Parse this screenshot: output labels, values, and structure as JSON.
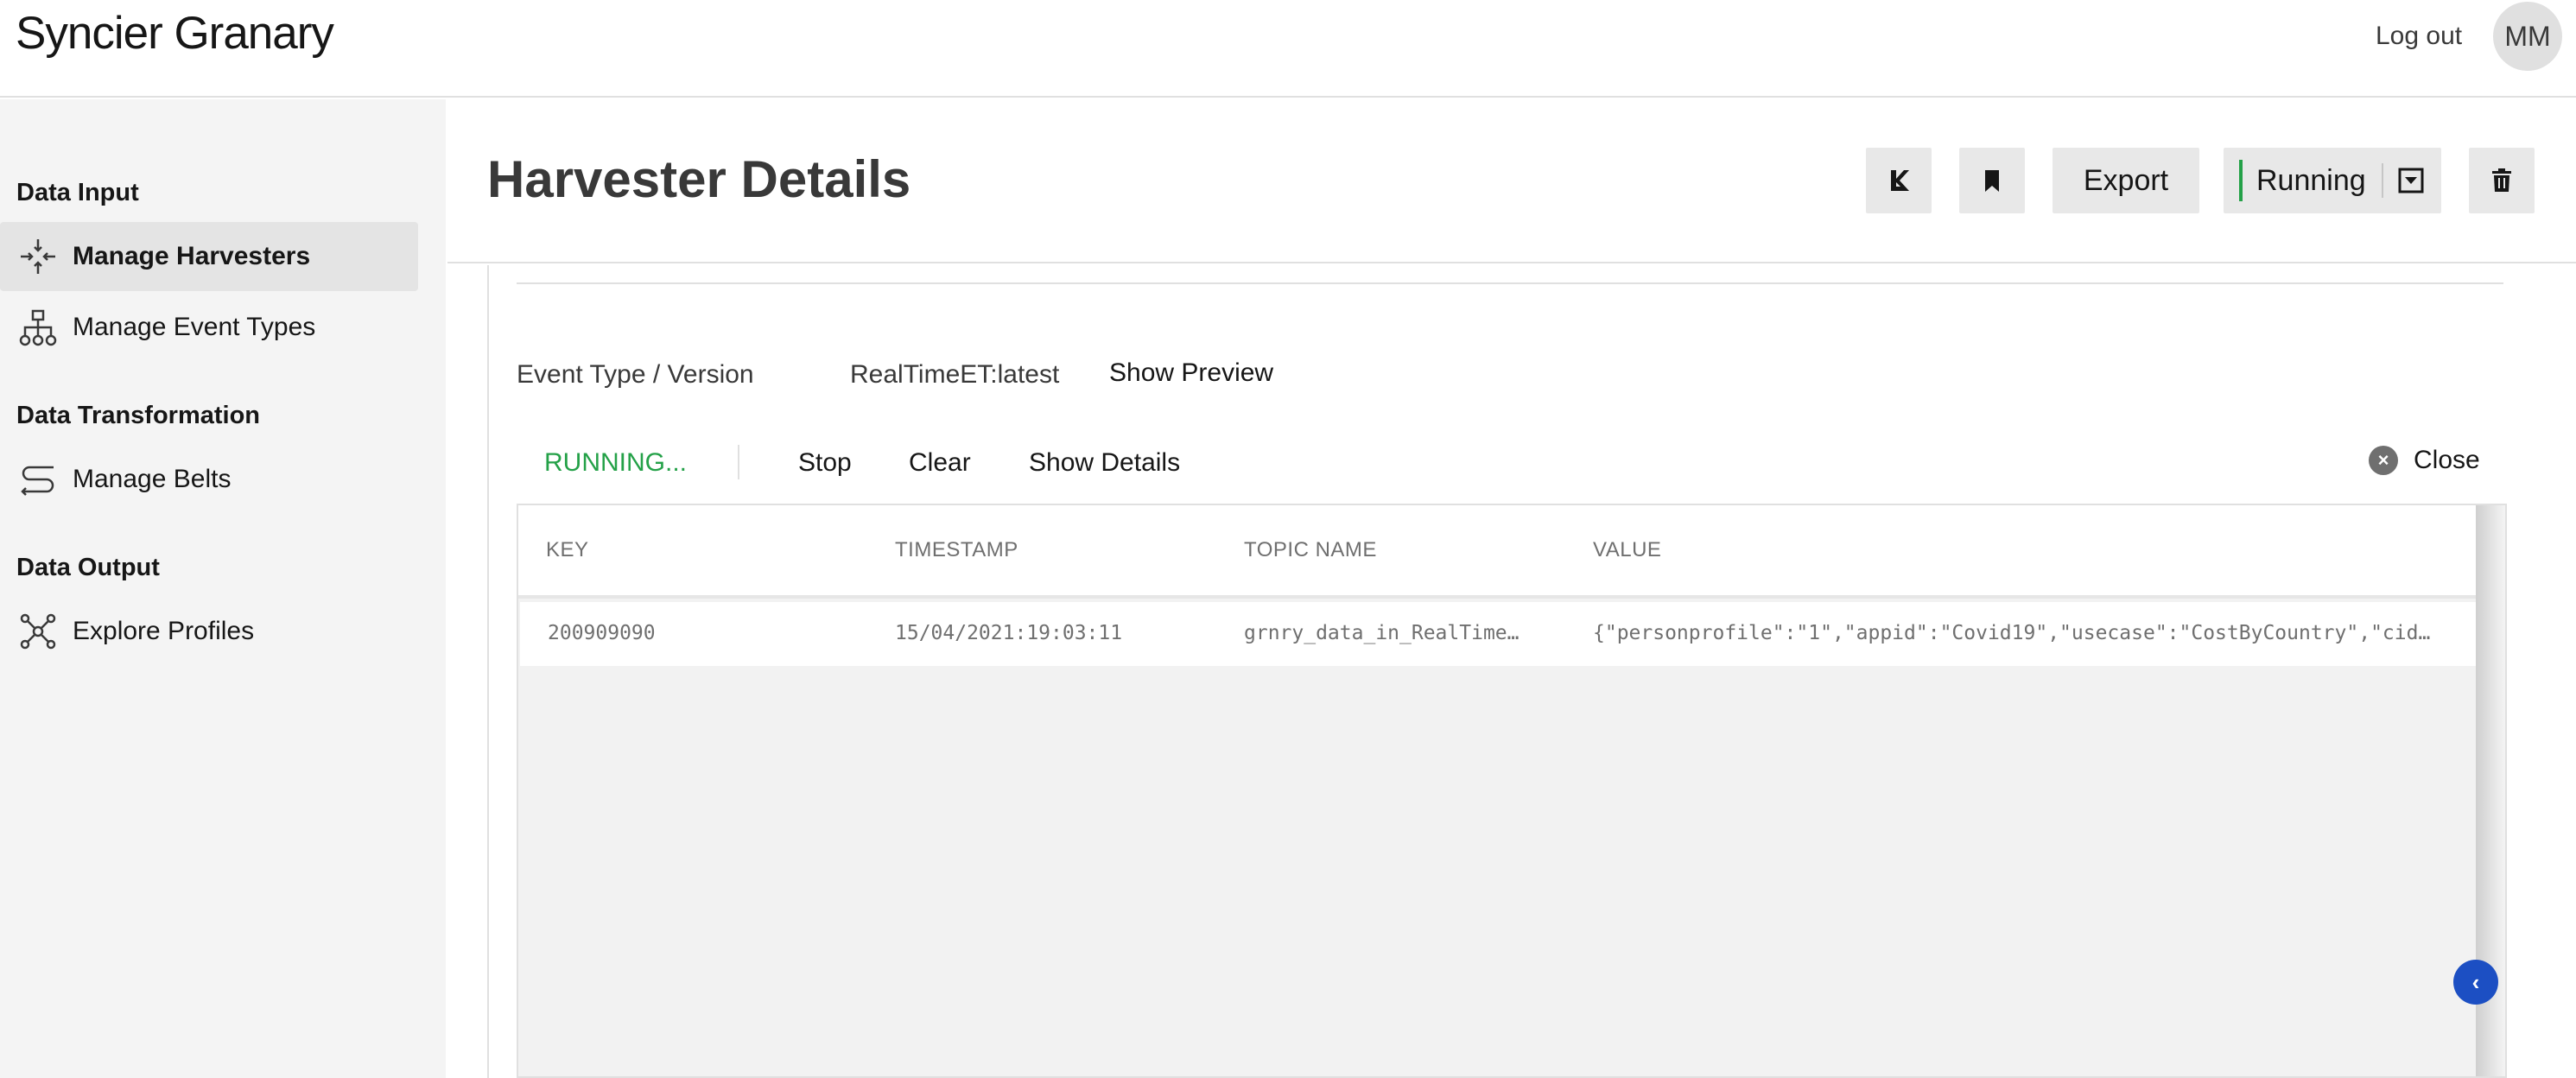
{
  "app": {
    "title": "Syncier Granary",
    "logout_label": "Log out",
    "avatar_initials": "MM"
  },
  "sidebar": {
    "sections": [
      {
        "label": "Data Input"
      },
      {
        "label": "Data Transformation"
      },
      {
        "label": "Data Output"
      }
    ],
    "items": [
      {
        "label": "Manage Harvesters",
        "icon": "harvester-icon",
        "active": true
      },
      {
        "label": "Manage Event Types",
        "icon": "hierarchy-icon"
      },
      {
        "label": "Manage Belts",
        "icon": "belt-icon"
      },
      {
        "label": "Explore Profiles",
        "icon": "network-icon"
      }
    ]
  },
  "header": {
    "title": "Harvester Details",
    "export_label": "Export",
    "status_label": "Running",
    "icons": [
      "kafka-icon",
      "bookmark-icon",
      "chevron-down-icon",
      "trash-icon"
    ]
  },
  "details": {
    "event_type_label": "Event Type / Version",
    "event_type_value": "RealTimeET:latest",
    "show_preview_label": "Show Preview"
  },
  "preview": {
    "status": "RUNNING...",
    "stop_label": "Stop",
    "clear_label": "Clear",
    "show_details_label": "Show Details",
    "close_label": "Close",
    "columns": [
      "KEY",
      "TIMESTAMP",
      "TOPIC NAME",
      "VALUE"
    ],
    "rows": [
      {
        "key": "200909090",
        "timestamp": "15/04/2021:19:03:11",
        "topic": "grnry_data_in_RealTime…",
        "value": "{\"personprofile\":\"1\",\"appid\":\"Covid19\",\"usecase\":\"CostByCountry\",\"cid…"
      }
    ]
  },
  "colors": {
    "accent": "#24a148",
    "collapse": "#1c4fc3"
  }
}
